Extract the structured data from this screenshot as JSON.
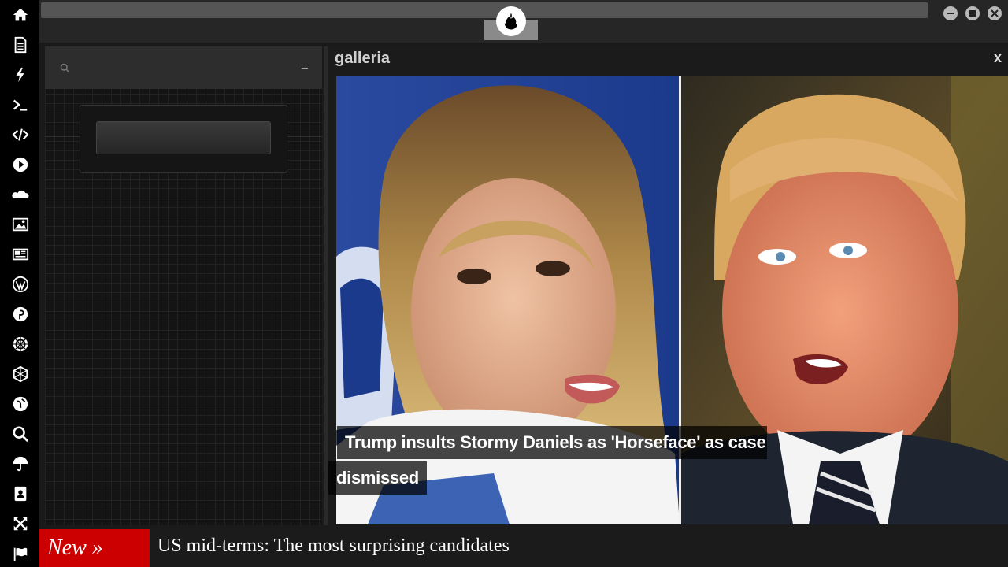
{
  "panel": {
    "title": "galleria",
    "close_label": "x",
    "minimize_label": "–"
  },
  "gallery": {
    "caption_line1": "Trump insults Stormy Daniels as 'Horseface' as case",
    "caption_line2": "dismissed"
  },
  "ticker": {
    "badge": "New »",
    "headline": "US mid-terms: The most surprising candidates"
  },
  "colors": {
    "ticker_badge": "#cc0000",
    "rail": "#000000",
    "panel_bg": "#1b1b1b"
  },
  "rail_icons": [
    "home-icon",
    "document-icon",
    "bolt-icon",
    "terminal-icon",
    "code-icon",
    "play-icon",
    "cloud-icon",
    "image-icon",
    "newspaper-icon",
    "wordpress-icon",
    "pinterest-icon",
    "galactic-empire-icon",
    "jedi-order-icon",
    "globe-icon",
    "search-icon",
    "umbrella-icon",
    "contacts-icon",
    "expand-icon",
    "flag-icon"
  ]
}
